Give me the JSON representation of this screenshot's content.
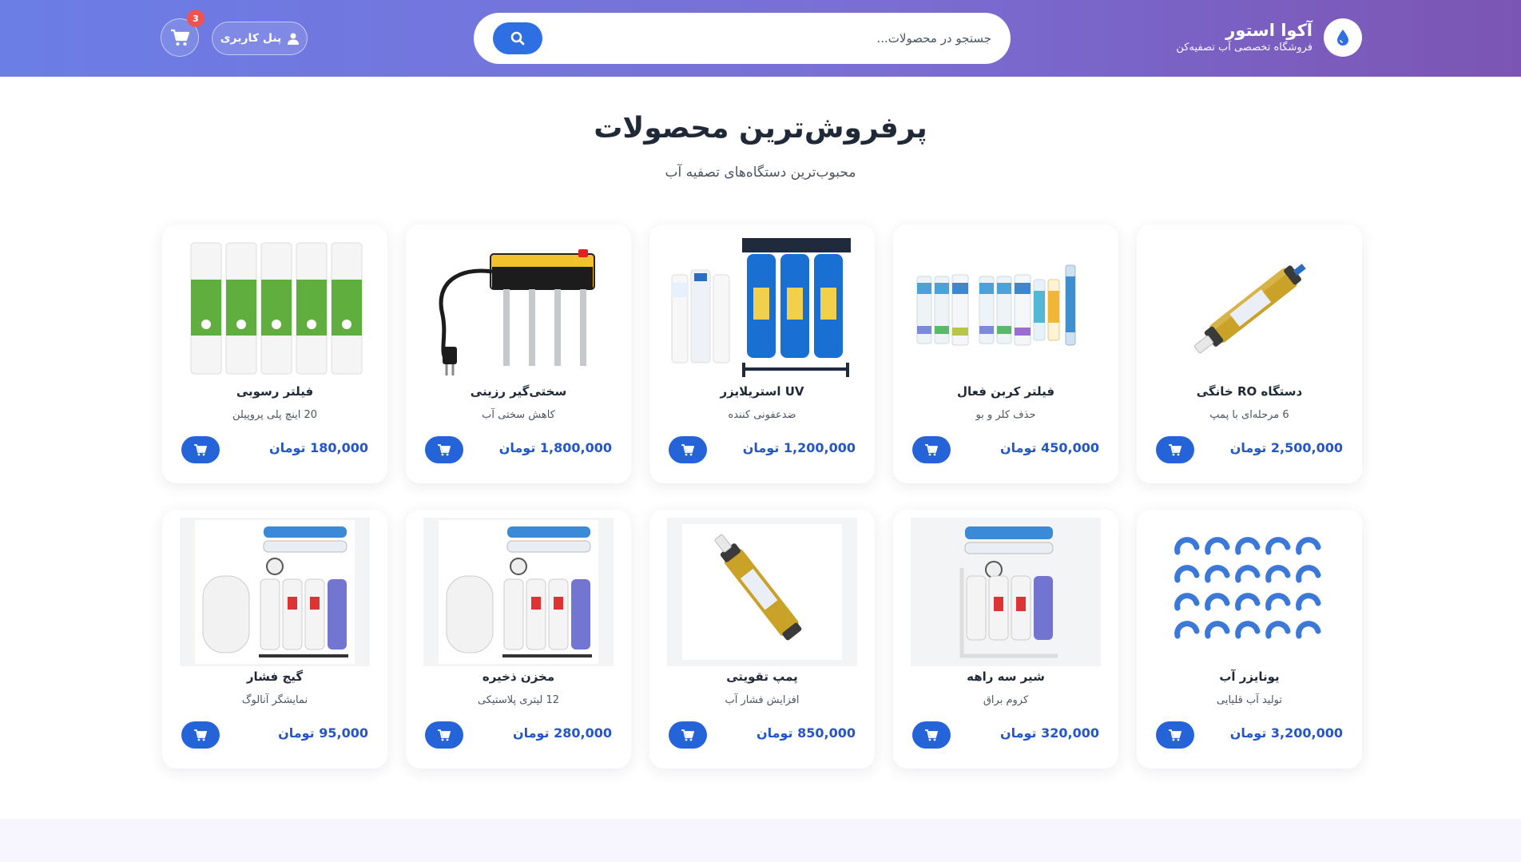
{
  "header": {
    "brand_name": "آکوا استور",
    "brand_tagline": "فروشگاه تخصصی آب تصفیه‌کن",
    "search_placeholder": "جستجو در محصولات...",
    "user_panel_label": "پنل کاربری",
    "cart_count": "3"
  },
  "section": {
    "title": "پرفروش‌ترین محصولات",
    "subtitle": "محبوب‌ترین دستگاه‌های تصفیه آب"
  },
  "products": [
    {
      "name": "دستگاه RO خانگی",
      "desc": "6 مرحله‌ای با پمپ",
      "price": "2,500,000 تومان",
      "image": "ro-membrane-icon"
    },
    {
      "name": "فیلتر کربن فعال",
      "desc": "حذف کلر و بو",
      "price": "450,000 تومان",
      "image": "filter-set-icon"
    },
    {
      "name": "UV استریلایزر",
      "desc": "ضدعفونی کننده",
      "price": "1,200,000 تومان",
      "image": "housing-filters-icon"
    },
    {
      "name": "سختی‌گیر رزینی",
      "desc": "کاهش سختی آب",
      "price": "1,800,000 تومان",
      "image": "tds-tester-icon"
    },
    {
      "name": "فیلتر رسوبی",
      "desc": "20 اینچ پلی پروپیلن",
      "price": "180,000 تومان",
      "image": "sediment-filters-icon"
    },
    {
      "name": "یونایزر آب",
      "desc": "تولید آب قلیایی",
      "price": "3,200,000 تومان",
      "image": "u-clips-icon"
    },
    {
      "name": "شیر سه راهه",
      "desc": "کروم براق",
      "price": "320,000 تومان",
      "image": "ro-system-icon"
    },
    {
      "name": "پمپ تقویتی",
      "desc": "افزایش فشار آب",
      "price": "850,000 تومان",
      "image": "ro-membrane-icon"
    },
    {
      "name": "مخزن ذخیره",
      "desc": "12 لیتری پلاستیکی",
      "price": "280,000 تومان",
      "image": "ro-system-tank-icon"
    },
    {
      "name": "گیج فشار",
      "desc": "نمایشگر آنالوگ",
      "price": "95,000 تومان",
      "image": "ro-system-tank-icon"
    }
  ],
  "colors": {
    "primary": "#2563d9",
    "header_from": "#6a7ee6",
    "header_to": "#7b55b3",
    "badge": "#ef5350"
  }
}
